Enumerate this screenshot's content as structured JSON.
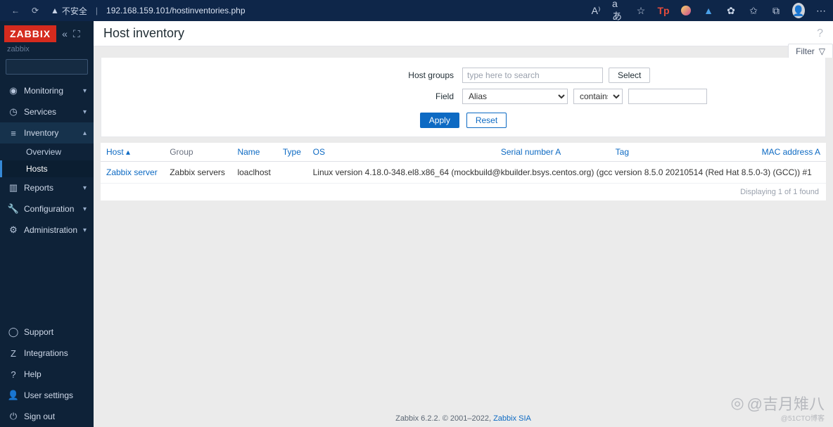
{
  "browser": {
    "insecure_label": "不安全",
    "url": "192.168.159.101/hostinventories.php"
  },
  "sidebar": {
    "logo": "ZABBIX",
    "tenant": "zabbix",
    "search_placeholder": "",
    "items": [
      {
        "icon": "◉",
        "label": "Monitoring",
        "caret": "▾"
      },
      {
        "icon": "◷",
        "label": "Services",
        "caret": "▾"
      },
      {
        "icon": "≡",
        "label": "Inventory",
        "caret": "▴",
        "active": true,
        "subs": [
          {
            "label": "Overview"
          },
          {
            "label": "Hosts",
            "active": true
          }
        ]
      },
      {
        "icon": "▥",
        "label": "Reports",
        "caret": "▾"
      },
      {
        "icon": "🔧",
        "label": "Configuration",
        "caret": "▾"
      },
      {
        "icon": "⚙",
        "label": "Administration",
        "caret": "▾"
      }
    ],
    "bottom": [
      {
        "icon": "◯",
        "label": "Support"
      },
      {
        "icon": "Z",
        "label": "Integrations"
      },
      {
        "icon": "?",
        "label": "Help"
      },
      {
        "icon": "👤",
        "label": "User settings"
      },
      {
        "icon": "⏻",
        "label": "Sign out"
      }
    ]
  },
  "page": {
    "title": "Host inventory",
    "filter_tab": "Filter",
    "filter": {
      "hostgroups_label": "Host groups",
      "hostgroups_placeholder": "type here to search",
      "select_btn": "Select",
      "field_label": "Field",
      "field_options": [
        "Alias"
      ],
      "comparator_options": [
        "contains"
      ],
      "value": "",
      "apply": "Apply",
      "reset": "Reset"
    },
    "table": {
      "columns": [
        "Host",
        "Group",
        "Name",
        "Type",
        "OS",
        "Serial number A",
        "Tag",
        "MAC address A"
      ],
      "sort_col": "Host",
      "rows": [
        {
          "host": "Zabbix server",
          "group": "Zabbix servers",
          "name": "loaclhost",
          "type": "",
          "os": "Linux version 4.18.0-348.el8.x86_64 (mockbuild@kbuilder.bsys.centos.org) (gcc version 8.5.0 20210514 (Red Hat 8.5.0-3) (GCC)) #1",
          "serial": "",
          "tag": "",
          "mac": ""
        }
      ],
      "footer": "Displaying 1 of 1 found"
    },
    "footer_text": "Zabbix 6.2.2. © 2001–2022, ",
    "footer_link": "Zabbix SIA"
  },
  "watermark": {
    "main": "@吉月雉八",
    "sub": "@51CTO博客"
  }
}
